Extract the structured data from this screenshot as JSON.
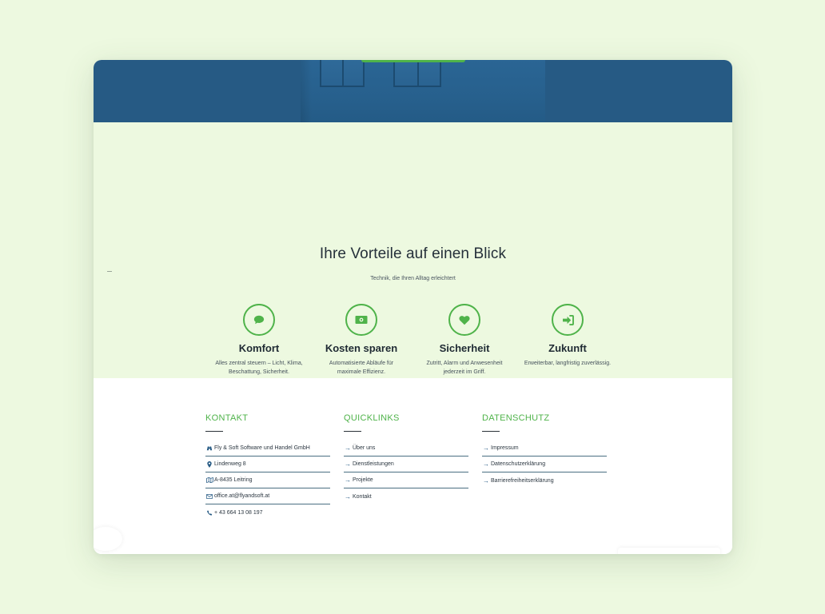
{
  "colors": {
    "accent": "#4fb34a",
    "navy": "#265a84",
    "features_bg": "#edf9e0",
    "page_bg": "#edf9e0"
  },
  "features": {
    "title": "Ihre Vorteile auf einen Blick",
    "subtitle": "Technik, die Ihren Alltag erleichtert",
    "items": [
      {
        "icon": "chat-bubble-icon",
        "label": "Komfort",
        "text": "Alles zentral steuern – Licht, Klima, Beschattung, Sicherheit."
      },
      {
        "icon": "money-bill-icon",
        "label": "Kosten sparen",
        "text": "Automatisierte Abläufe für maximale Effizienz."
      },
      {
        "icon": "heart-icon",
        "label": "Sicherheit",
        "text": "Zutritt, Alarm und Anwesenheit jederzeit im Griff."
      },
      {
        "icon": "sign-in-icon",
        "label": "Zukunft",
        "text": "Erweiterbar, langfristig zuverlässig."
      }
    ]
  },
  "footer": {
    "kontakt": {
      "heading": "KONTAKT",
      "rows": [
        {
          "icon": "binoculars-icon",
          "text": "Fly & Soft Software und Handel GmbH"
        },
        {
          "icon": "map-marker-icon",
          "text": "Lindenweg 8"
        },
        {
          "icon": "map-icon",
          "text": "A-8435 Leitring"
        },
        {
          "icon": "envelope-icon",
          "text": "office.at@flyandsoft.at"
        },
        {
          "icon": "phone-icon",
          "text": "+ 43 664 13 08 197"
        }
      ]
    },
    "quicklinks": {
      "heading": "QUICKLINKS",
      "links": [
        "Über uns",
        "Dienstleistungen",
        "Projekte",
        "Kontakt"
      ]
    },
    "datenschutz": {
      "heading": "DATENSCHUTZ",
      "links": [
        "Impressum",
        "Datenschutzerklärung",
        "Barrierefreiheitserklärung"
      ]
    }
  }
}
